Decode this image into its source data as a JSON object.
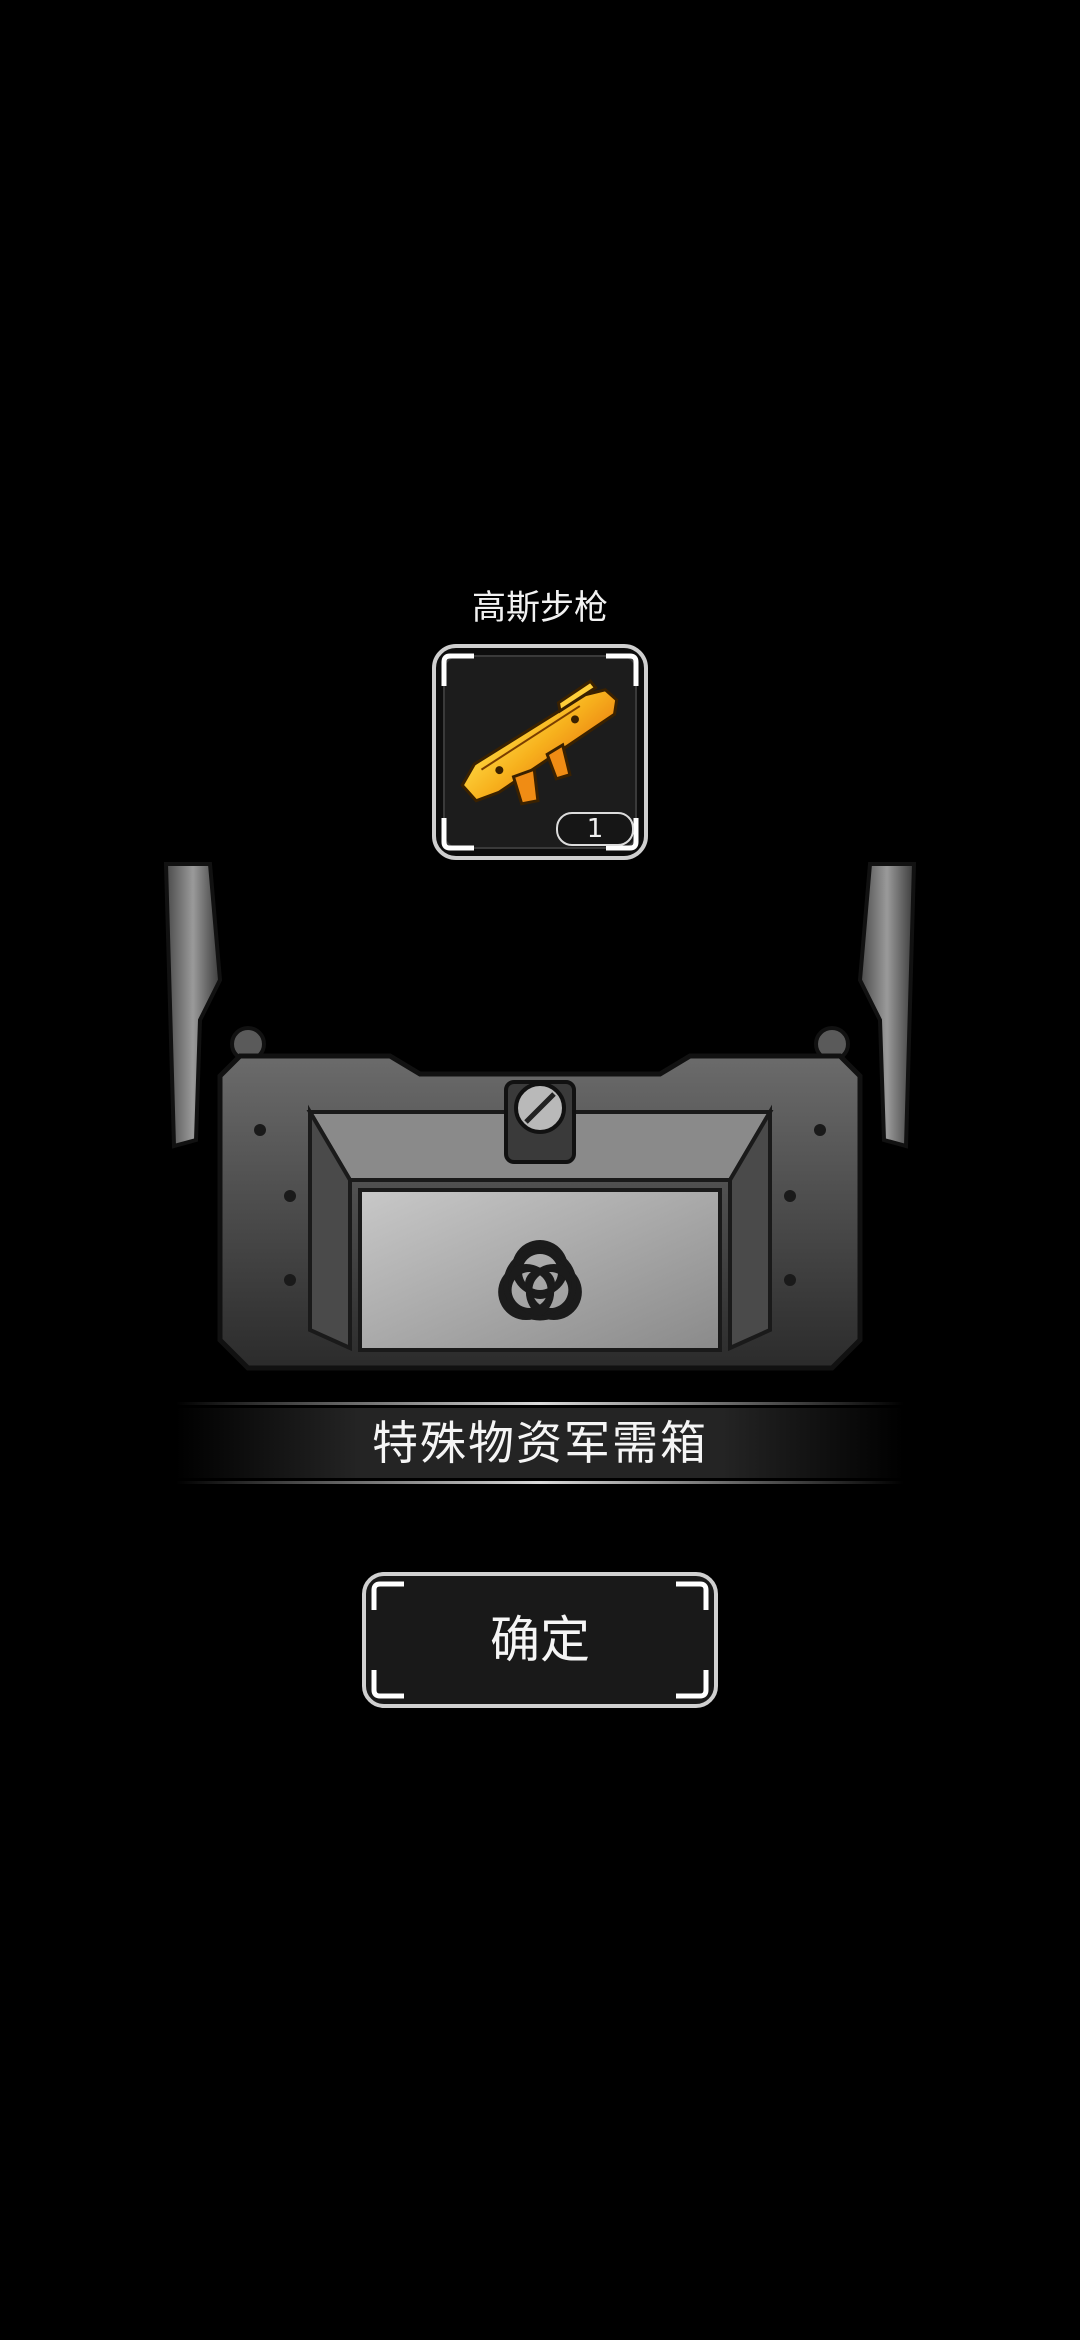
{
  "reward": {
    "name": "高斯步枪",
    "count": "1",
    "icon": "gauss-rifle-icon",
    "rarity_color": "#f0a020"
  },
  "crate": {
    "title": "特殊物资军需箱",
    "icon": "biohazard-icon"
  },
  "confirm": {
    "label": "确定"
  }
}
